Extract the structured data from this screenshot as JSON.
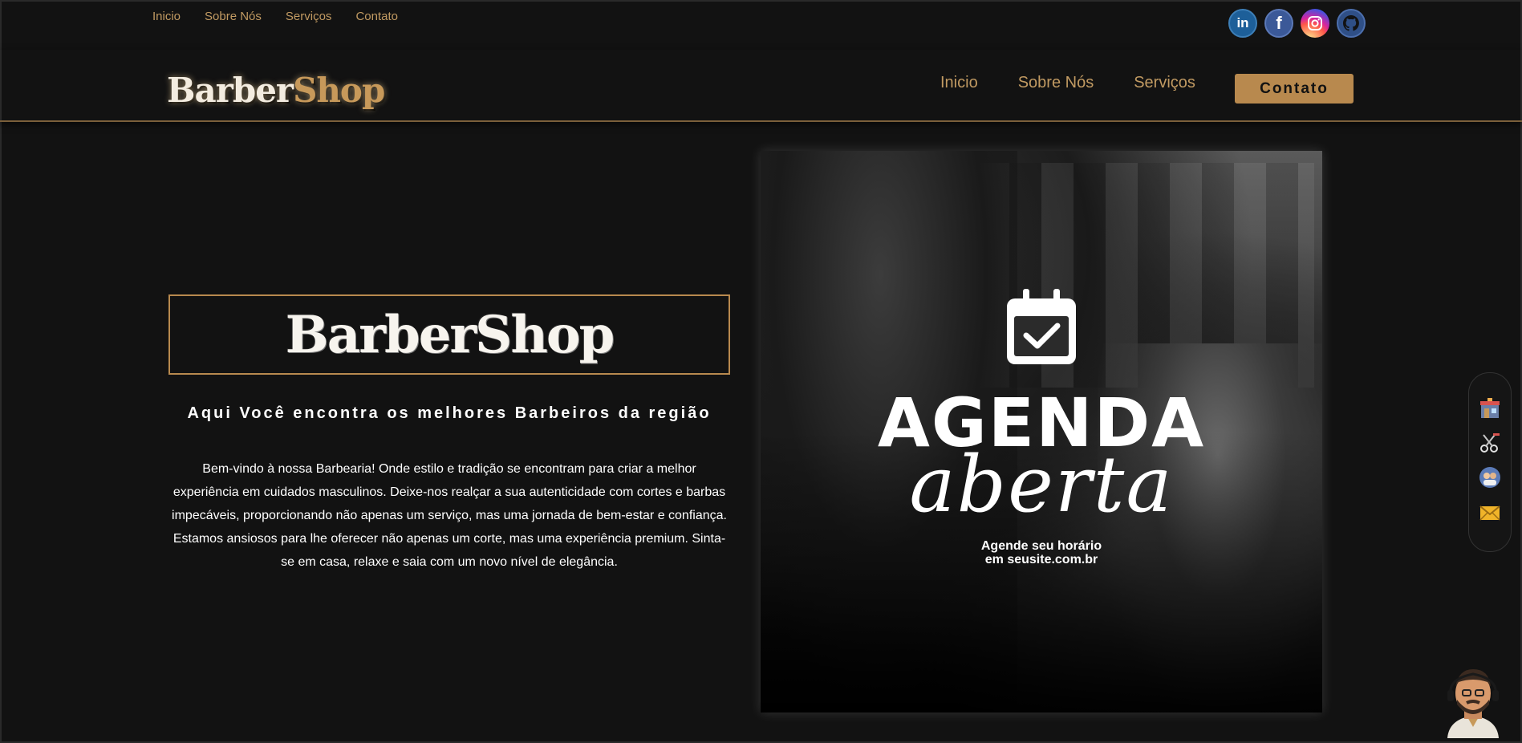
{
  "topbar": {
    "links": [
      "Inicio",
      "Sobre Nós",
      "Serviços",
      "Contato"
    ]
  },
  "socials": {
    "linkedin_label": "in",
    "facebook_label": "f"
  },
  "navbar": {
    "logo_part1": "Barber",
    "logo_part2": "Shop",
    "links": [
      "Inicio",
      "Sobre Nós",
      "Serviços"
    ],
    "cta_label": "Contato"
  },
  "hero": {
    "title": "BarberShop",
    "subtitle": "Aqui Você encontra os melhores Barbeiros da região",
    "text": "Bem-vindo à nossa Barbearia! Onde estilo e tradição se encontram para criar a melhor experiência em cuidados masculinos. Deixe-nos realçar a sua autenticidade com cortes e barbas impecáveis, proporcionando não apenas um serviço, mas uma jornada de bem-estar e confiança. Estamos ansiosos para lhe oferecer não apenas um corte, mas uma experiência premium. Sinta-se em casa, relaxe e saia com um novo nível de elegância."
  },
  "promo": {
    "headline": "AGENDA",
    "script": "aberta",
    "caption_line1": "Agende seu horário",
    "caption_line2": "em seusite.com.br"
  },
  "colors": {
    "background": "#121212",
    "accent": "#b8894e",
    "link": "#c19a62"
  },
  "icons": {
    "dock": [
      "barbershop-icon",
      "scissors-razor-icon",
      "barber-team-icon",
      "envelope-icon"
    ],
    "assistant": "barber-assistant-icon"
  }
}
